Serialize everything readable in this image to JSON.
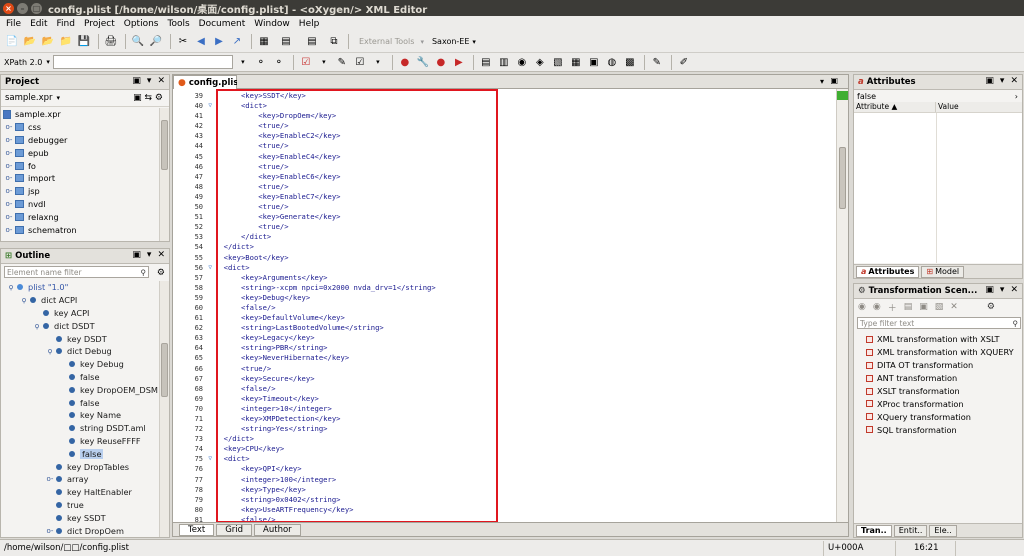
{
  "window": {
    "title": "config.plist [/home/wilson/桌面/config.plist] - <oXygen/> XML Editor"
  },
  "menu": [
    "File",
    "Edit",
    "Find",
    "Project",
    "Options",
    "Tools",
    "Document",
    "Window",
    "Help"
  ],
  "toolbar": {
    "external_tools": "External Tools",
    "engine": "Saxon-EE",
    "xpath_label": "XPath 2.0"
  },
  "project": {
    "title": "Project",
    "selector": "sample.xpr",
    "items": [
      "sample.xpr",
      "css",
      "debugger",
      "epub",
      "fo",
      "import",
      "jsp",
      "nvdl",
      "relaxng",
      "schematron"
    ]
  },
  "outline": {
    "title": "Outline",
    "filter_placeholder": "Element name filter",
    "rows": [
      {
        "t": "plist \"1.0\""
      },
      {
        "t": "dict  ACPI"
      },
      {
        "t": "key  ACPI"
      },
      {
        "t": "dict  DSDT"
      },
      {
        "t": "key  DSDT"
      },
      {
        "t": "dict  Debug"
      },
      {
        "t": "key  Debug"
      },
      {
        "t": "false"
      },
      {
        "t": "key  DropOEM_DSM"
      },
      {
        "t": "false"
      },
      {
        "t": "key  Name"
      },
      {
        "t": "string  DSDT.aml"
      },
      {
        "t": "key  ReuseFFFF"
      },
      {
        "t": "false"
      },
      {
        "t": "key  DropTables"
      },
      {
        "t": "array"
      },
      {
        "t": "key  HaltEnabler"
      },
      {
        "t": "true"
      },
      {
        "t": "key  SSDT"
      },
      {
        "t": "dict  DropOem"
      }
    ]
  },
  "editor": {
    "tab": "config.plist",
    "bottom_tabs": [
      "Text",
      "Grid",
      "Author"
    ],
    "lines": [
      {
        "n": "39",
        "c": "      <key>SSDT</key>"
      },
      {
        "n": "40",
        "c": "      <dict>"
      },
      {
        "n": "41",
        "c": "          <key>DropOem</key>"
      },
      {
        "n": "42",
        "c": "          <true/>"
      },
      {
        "n": "43",
        "c": "          <key>EnableC2</key>"
      },
      {
        "n": "44",
        "c": "          <true/>"
      },
      {
        "n": "45",
        "c": "          <key>EnableC4</key>"
      },
      {
        "n": "46",
        "c": "          <true/>"
      },
      {
        "n": "47",
        "c": "          <key>EnableC6</key>"
      },
      {
        "n": "48",
        "c": "          <true/>"
      },
      {
        "n": "49",
        "c": "          <key>EnableC7</key>"
      },
      {
        "n": "50",
        "c": "          <true/>"
      },
      {
        "n": "51",
        "c": "          <key>Generate</key>"
      },
      {
        "n": "52",
        "c": "          <true/>"
      },
      {
        "n": "53",
        "c": "      </dict>"
      },
      {
        "n": "54",
        "c": "  </dict>"
      },
      {
        "n": "55",
        "c": "  <key>Boot</key>"
      },
      {
        "n": "56",
        "c": "  <dict>"
      },
      {
        "n": "57",
        "c": "      <key>Arguments</key>"
      },
      {
        "n": "58",
        "c": "      <string>-xcpm npci=0x2000 nvda_drv=1</string>"
      },
      {
        "n": "59",
        "c": "      <key>Debug</key>"
      },
      {
        "n": "60",
        "c": "      <false/>"
      },
      {
        "n": "61",
        "c": "      <key>DefaultVolume</key>"
      },
      {
        "n": "62",
        "c": "      <string>LastBootedVolume</string>"
      },
      {
        "n": "63",
        "c": "      <key>Legacy</key>"
      },
      {
        "n": "64",
        "c": "      <string>PBR</string>"
      },
      {
        "n": "65",
        "c": "      <key>NeverHibernate</key>"
      },
      {
        "n": "66",
        "c": "      <true/>"
      },
      {
        "n": "67",
        "c": "      <key>Secure</key>"
      },
      {
        "n": "68",
        "c": "      <false/>"
      },
      {
        "n": "69",
        "c": "      <key>Timeout</key>"
      },
      {
        "n": "70",
        "c": "      <integer>10</integer>"
      },
      {
        "n": "71",
        "c": "      <key>XMPDetection</key>"
      },
      {
        "n": "72",
        "c": "      <string>Yes</string>"
      },
      {
        "n": "73",
        "c": "  </dict>"
      },
      {
        "n": "74",
        "c": "  <key>CPU</key>"
      },
      {
        "n": "75",
        "c": "  <dict>"
      },
      {
        "n": "76",
        "c": "      <key>QPI</key>"
      },
      {
        "n": "77",
        "c": "      <integer>100</integer>"
      },
      {
        "n": "78",
        "c": "      <key>Type</key>"
      },
      {
        "n": "79",
        "c": "      <string>0x0402</string>"
      },
      {
        "n": "80",
        "c": "      <key>UseARTFrequency</key>"
      },
      {
        "n": "81",
        "c": "      <false/>"
      }
    ]
  },
  "attributes": {
    "title": "Attributes",
    "value": "false",
    "col_attribute": "Attribute ▲",
    "col_value": "Value",
    "tabs": [
      "Attributes",
      "Model"
    ]
  },
  "transform": {
    "title": "Transformation Scen...",
    "filter_placeholder": "Type filter text",
    "items": [
      "XML transformation with XSLT",
      "XML transformation with XQUERY",
      "DITA OT transformation",
      "ANT transformation",
      "XSLT transformation",
      "XProc transformation",
      "XQuery transformation",
      "SQL transformation"
    ],
    "tabs": [
      "Tran..",
      "Entit..",
      "Ele.."
    ]
  },
  "status": {
    "path": "/home/wilson/□□/config.plist",
    "unicode": "U+000A",
    "position": "16:21"
  }
}
